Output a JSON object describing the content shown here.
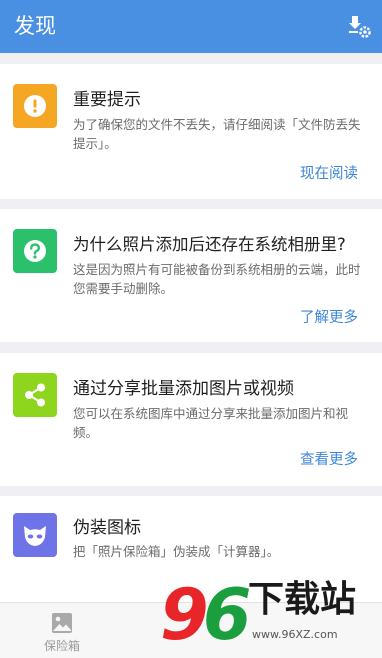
{
  "header": {
    "title": "发现"
  },
  "cards": [
    {
      "title": "重要提示",
      "description": "为了确保您的文件不丢失，请仔细阅读「文件防丢失提示」。",
      "link": "现在阅读",
      "icon": "exclamation-icon",
      "color": "#f5a623"
    },
    {
      "title": "为什么照片添加后还存在系统相册里?",
      "description": "这是因为照片有可能被备份到系统相册的云端，此时您需要手动删除。",
      "link": "了解更多",
      "icon": "question-icon",
      "color": "#2bc16c"
    },
    {
      "title": "通过分享批量添加图片或视频",
      "description": "您可以在系统图库中通过分享来批量添加图片和视频。",
      "link": "查看更多",
      "icon": "share-icon",
      "color": "#8ed61e"
    },
    {
      "title": "伪装图标",
      "description": "把「照片保险箱」伪装成「计算器」。",
      "icon": "mask-icon",
      "color": "#6f73e8"
    }
  ],
  "tabbar": {
    "tabs": [
      {
        "label": "保险箱",
        "icon": "image-icon"
      }
    ]
  },
  "watermark": {
    "num": "96",
    "text": "下载站",
    "url": "www.96XZ.com"
  }
}
